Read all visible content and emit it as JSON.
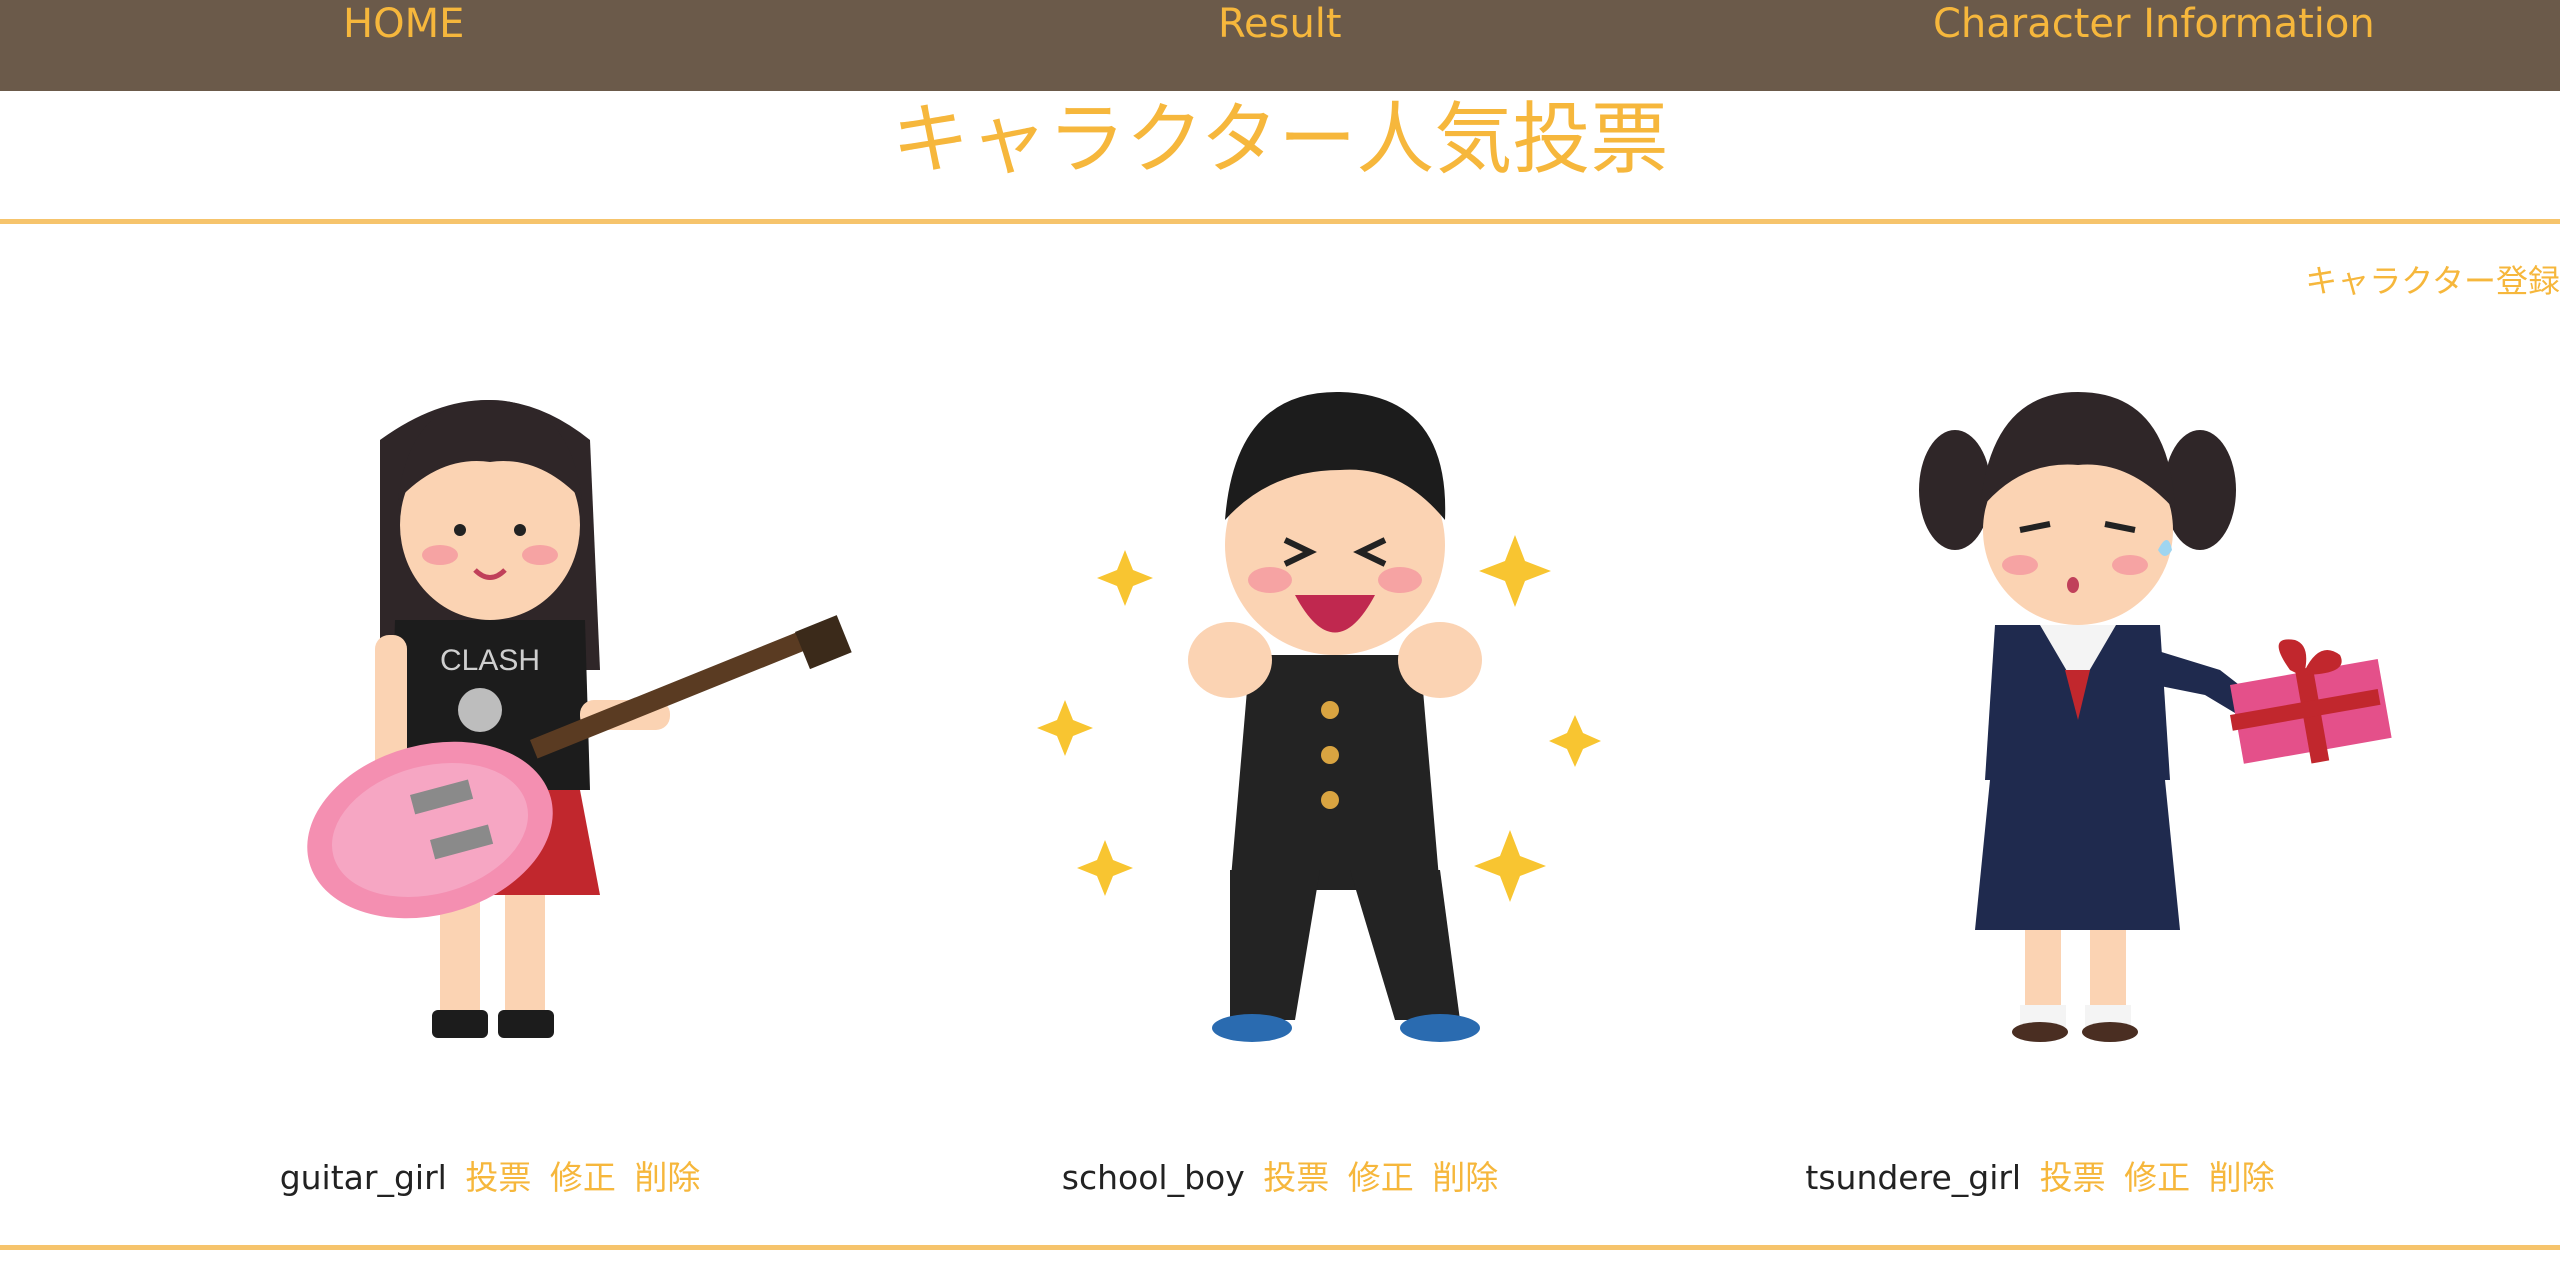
{
  "nav": {
    "home": "HOME",
    "result": "Result",
    "info": "Character Information"
  },
  "page": {
    "title": "キャラクター人気投票",
    "register": "キャラクター登録"
  },
  "characters": [
    {
      "name": "guitar_girl",
      "vote": "投票",
      "edit": "修正",
      "delete": "削除"
    },
    {
      "name": "school_boy",
      "vote": "投票",
      "edit": "修正",
      "delete": "削除"
    },
    {
      "name": "tsundere_girl",
      "vote": "投票",
      "edit": "修正",
      "delete": "削除"
    }
  ],
  "colors": {
    "navbar_bg": "#6b5a4a",
    "accent": "#f6b73c",
    "divider": "#f6c46c",
    "text": "#222222"
  }
}
